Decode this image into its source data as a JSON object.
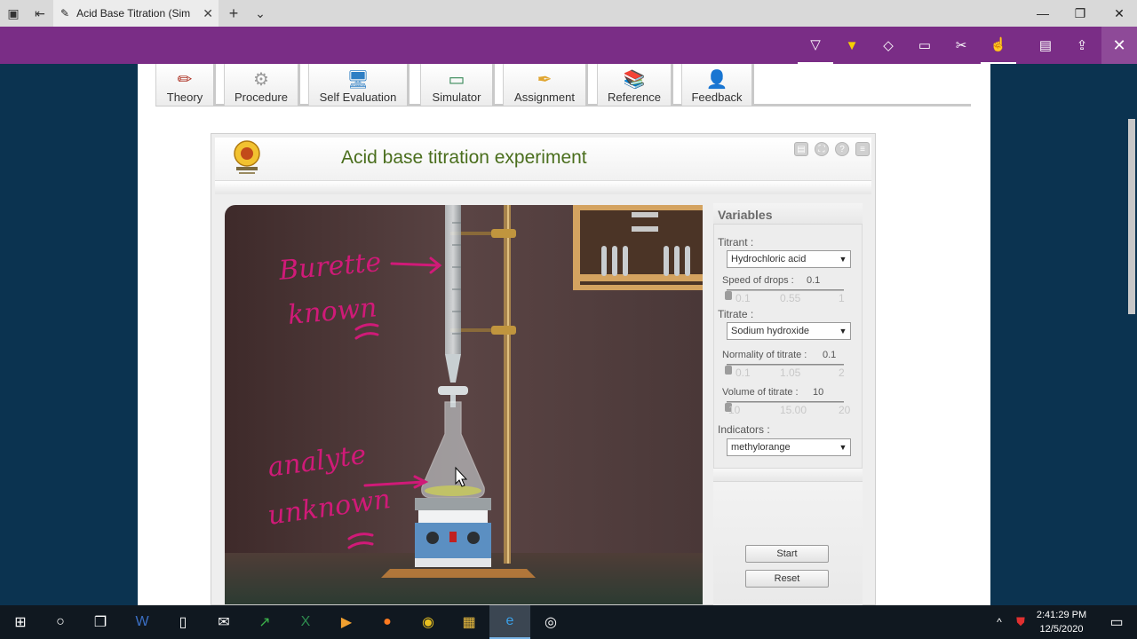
{
  "browser": {
    "tab_title": "Acid Base Titration (Sim",
    "tab_close": "✕",
    "new_tab": "+",
    "tab_menu": "⌄"
  },
  "nav_tabs": [
    {
      "label": "Theory",
      "icon": "pencil-icon"
    },
    {
      "label": "Procedure",
      "icon": "gears-icon"
    },
    {
      "label": "Self Evaluation",
      "icon": "monitor-icon"
    },
    {
      "label": "Simulator",
      "icon": "computer-icon"
    },
    {
      "label": "Assignment",
      "icon": "quill-icon"
    },
    {
      "label": "Reference",
      "icon": "books-icon"
    },
    {
      "label": "Feedback",
      "icon": "person-icon"
    }
  ],
  "simulator": {
    "title": "Acid base titration experiment"
  },
  "annotations": {
    "burette": "Burette known",
    "analyte": "analyte unknown"
  },
  "variables": {
    "title": "Variables",
    "titrant_label": "Titrant :",
    "titrant_value": "Hydrochloric acid",
    "speed_label": "Speed of drops :",
    "speed_value": "0.1",
    "speed_ticks": [
      "0.1",
      "0.55",
      "1"
    ],
    "titrate_label": "Titrate :",
    "titrate_value": "Sodium hydroxide",
    "normality_label": "Normality of titrate :",
    "normality_value": "0.1",
    "normality_ticks": [
      "0.1",
      "1.05",
      "2"
    ],
    "volume_label": "Volume of titrate :",
    "volume_value": "10",
    "volume_ticks": [
      "10",
      "15.00",
      "20"
    ],
    "indicators_label": "Indicators :",
    "indicators_value": "methylorange",
    "start": "Start",
    "reset": "Reset"
  },
  "taskbar": {
    "time": "2:41:29 PM",
    "date": "12/5/2020"
  },
  "colors": {
    "command_bar": "#7a2d86",
    "title_green": "#4a6e1d",
    "ink": "#d01a78",
    "desktop": "#0b3350"
  }
}
